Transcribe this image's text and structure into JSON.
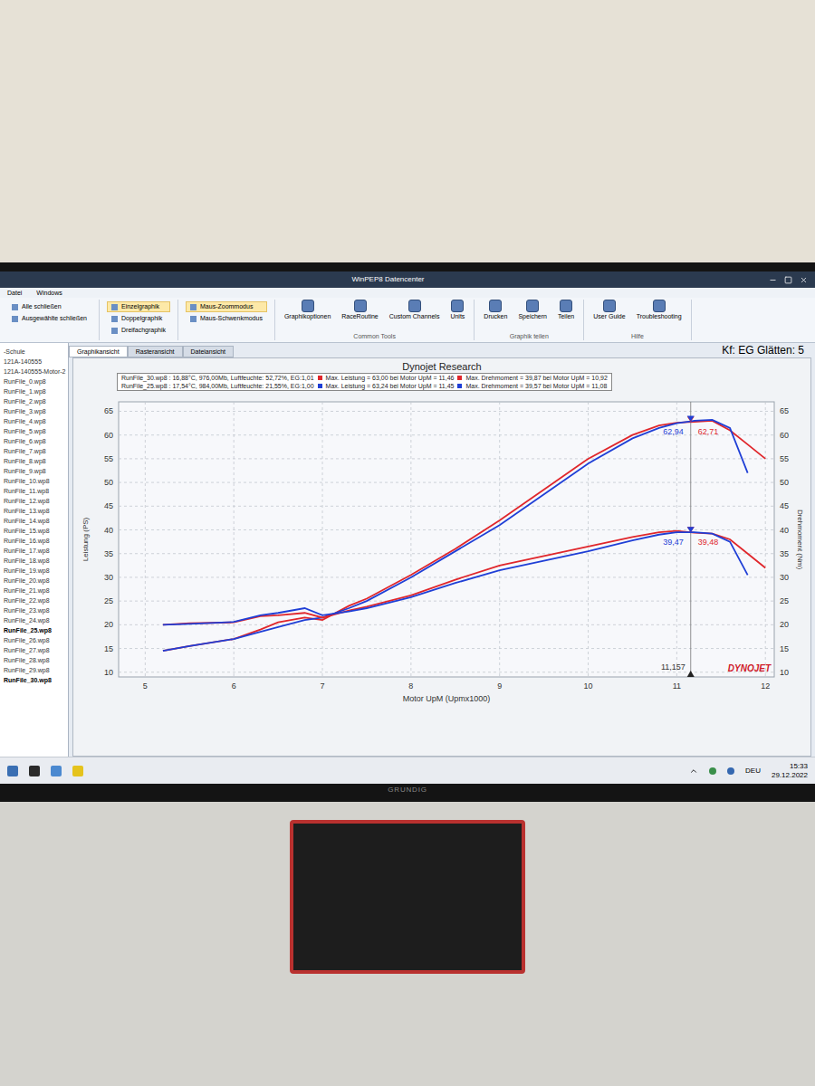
{
  "window": {
    "title": "WinPEP8 Datencenter"
  },
  "menu": [
    "Datei",
    "Windows"
  ],
  "ribbon": {
    "groups": [
      {
        "kind": "small",
        "items": [
          {
            "label": "Alle schließen",
            "selected": false
          },
          {
            "label": "Ausgewählte schließen",
            "selected": false
          }
        ]
      },
      {
        "kind": "small",
        "items": [
          {
            "label": "Einzelgraphik",
            "selected": true
          },
          {
            "label": "Doppelgraphik",
            "selected": false
          },
          {
            "label": "Dreifachgraphik",
            "selected": false
          }
        ]
      },
      {
        "kind": "small",
        "items": [
          {
            "label": "Maus-Zoommodus",
            "selected": true
          },
          {
            "label": "Maus-Schwenkmodus",
            "selected": false
          }
        ]
      },
      {
        "kind": "large",
        "label": "Common Tools",
        "items": [
          {
            "label": "Graphikoptionen",
            "selected": false
          },
          {
            "label": "RaceRoutine",
            "selected": false
          },
          {
            "label": "Custom Channels",
            "selected": false
          },
          {
            "label": "Units",
            "selected": false
          }
        ]
      },
      {
        "kind": "large",
        "label": "Graphik teilen",
        "items": [
          {
            "label": "Drucken",
            "selected": false
          },
          {
            "label": "Speichern",
            "selected": false
          },
          {
            "label": "Teilen",
            "selected": false
          }
        ]
      },
      {
        "kind": "large",
        "label": "Hilfe",
        "items": [
          {
            "label": "User Guide",
            "selected": false
          },
          {
            "label": "Troubleshooting",
            "selected": false
          }
        ]
      }
    ]
  },
  "tabs": [
    {
      "label": "Graphikansicht",
      "selected": true
    },
    {
      "label": "Rasteransicht",
      "selected": false
    },
    {
      "label": "Dateiansicht",
      "selected": false
    }
  ],
  "filter_label": "Kf: EG Glätten: 5",
  "sidebar": {
    "items": [
      {
        "label": "-Schule",
        "selected": false
      },
      {
        "label": "121A-140555",
        "selected": false
      },
      {
        "label": "121A-140555-Motor-2",
        "selected": false
      },
      {
        "label": "RunFile_0.wp8",
        "selected": false
      },
      {
        "label": "RunFile_1.wp8",
        "selected": false
      },
      {
        "label": "RunFile_2.wp8",
        "selected": false
      },
      {
        "label": "RunFile_3.wp8",
        "selected": false
      },
      {
        "label": "RunFile_4.wp8",
        "selected": false
      },
      {
        "label": "RunFile_5.wp8",
        "selected": false
      },
      {
        "label": "RunFile_6.wp8",
        "selected": false
      },
      {
        "label": "RunFile_7.wp8",
        "selected": false
      },
      {
        "label": "RunFile_8.wp8",
        "selected": false
      },
      {
        "label": "RunFile_9.wp8",
        "selected": false
      },
      {
        "label": "RunFile_10.wp8",
        "selected": false
      },
      {
        "label": "RunFile_11.wp8",
        "selected": false
      },
      {
        "label": "RunFile_12.wp8",
        "selected": false
      },
      {
        "label": "RunFile_13.wp8",
        "selected": false
      },
      {
        "label": "RunFile_14.wp8",
        "selected": false
      },
      {
        "label": "RunFile_15.wp8",
        "selected": false
      },
      {
        "label": "RunFile_16.wp8",
        "selected": false
      },
      {
        "label": "RunFile_17.wp8",
        "selected": false
      },
      {
        "label": "RunFile_18.wp8",
        "selected": false
      },
      {
        "label": "RunFile_19.wp8",
        "selected": false
      },
      {
        "label": "RunFile_20.wp8",
        "selected": false
      },
      {
        "label": "RunFile_21.wp8",
        "selected": false
      },
      {
        "label": "RunFile_22.wp8",
        "selected": false
      },
      {
        "label": "RunFile_23.wp8",
        "selected": false
      },
      {
        "label": "RunFile_24.wp8",
        "selected": false
      },
      {
        "label": "RunFile_25.wp8",
        "selected": true
      },
      {
        "label": "RunFile_26.wp8",
        "selected": false
      },
      {
        "label": "RunFile_27.wp8",
        "selected": false
      },
      {
        "label": "RunFile_28.wp8",
        "selected": false
      },
      {
        "label": "RunFile_29.wp8",
        "selected": false
      },
      {
        "label": "RunFile_30.wp8",
        "selected": true
      }
    ]
  },
  "chart": {
    "title": "Dynojet Research",
    "legend": [
      {
        "run": "RunFile_30.wp8 : 16,88°C, 976,00Mb, Luftfeuchte: 52,72%, EG:1,01",
        "power": "Max. Leistung = 63,00 bei Motor UpM = 11,46",
        "torque": "Max. Drehmoment = 39,87 bei Motor UpM = 10,92",
        "color": "#e0262b"
      },
      {
        "run": "RunFile_25.wp8 : 17,54°C, 984,00Mb, Luftfeuchte: 21,55%, EG:1,00",
        "power": "Max. Leistung = 63,24 bei Motor UpM = 11,45",
        "torque": "Max. Drehmoment = 39,57 bei Motor UpM = 11,08",
        "color": "#1f3fd6"
      }
    ],
    "x_axis": {
      "title": "Motor UpM (Upmx1000)",
      "ticks": [
        "5",
        "6",
        "7",
        "8",
        "9",
        "10",
        "11",
        "12"
      ]
    },
    "y_left": {
      "title": "Leistung (PS)",
      "ticks": [
        "10",
        "15",
        "20",
        "25",
        "30",
        "35",
        "40",
        "45",
        "50",
        "55",
        "60",
        "65"
      ]
    },
    "y_right": {
      "title": "Drehmoment (Nm)",
      "ticks": [
        "10",
        "15",
        "20",
        "25",
        "30",
        "35",
        "40",
        "45",
        "50",
        "55",
        "60",
        "65"
      ]
    },
    "cursor": {
      "rpm": 11.157,
      "label": "11,157"
    },
    "logo": "DYNOJET",
    "series": [
      {
        "axis": "left",
        "color": "#e0262b",
        "cursor_value": "62,71",
        "rpm": [
          5.2,
          5.5,
          6,
          6.3,
          6.5,
          6.8,
          7,
          7.3,
          7.5,
          8,
          8.5,
          9,
          9.5,
          10,
          10.5,
          10.8,
          11,
          11.2,
          11.4,
          11.6,
          11.8,
          12
        ],
        "values": [
          14.5,
          15.5,
          17,
          19,
          20.5,
          21.5,
          21,
          24,
          25.5,
          30.5,
          36,
          42,
          48.5,
          55,
          60,
          62,
          62.6,
          62.8,
          63,
          61,
          58,
          55
        ]
      },
      {
        "axis": "left",
        "color": "#1f3fd6",
        "cursor_value": "62,94",
        "rpm": [
          5.2,
          5.5,
          6,
          6.3,
          6.5,
          6.8,
          7,
          7.3,
          7.5,
          8,
          8.5,
          9,
          9.5,
          10,
          10.5,
          10.8,
          11,
          11.2,
          11.4,
          11.6,
          11.8
        ],
        "values": [
          14.5,
          15.5,
          17,
          18.5,
          19.5,
          21,
          21.5,
          23.5,
          25,
          30,
          35.5,
          41,
          47.5,
          54,
          59.3,
          61.5,
          62.5,
          63,
          63.2,
          61.5,
          52
        ]
      },
      {
        "axis": "right",
        "color": "#e0262b",
        "cursor_value": "39,48",
        "rpm": [
          5.2,
          5.5,
          6,
          6.3,
          6.5,
          6.8,
          7,
          7.3,
          7.5,
          8,
          8.5,
          9,
          9.5,
          10,
          10.5,
          10.8,
          11,
          11.2,
          11.4,
          11.6,
          11.8,
          12
        ],
        "values": [
          20,
          20.3,
          20.5,
          21.8,
          22,
          22.5,
          21.5,
          23,
          23.8,
          26.2,
          29.5,
          32.5,
          34.5,
          36.5,
          38.5,
          39.5,
          39.8,
          39.4,
          39.2,
          38,
          35,
          32
        ]
      },
      {
        "axis": "right",
        "color": "#1f3fd6",
        "cursor_value": "39,47",
        "rpm": [
          5.2,
          5.5,
          6,
          6.3,
          6.5,
          6.8,
          7,
          7.3,
          7.5,
          8,
          8.5,
          9,
          9.5,
          10,
          10.5,
          10.8,
          11,
          11.2,
          11.4,
          11.6,
          11.8
        ],
        "values": [
          20,
          20.2,
          20.6,
          22,
          22.5,
          23.5,
          22,
          22.8,
          23.5,
          25.8,
          28.8,
          31.5,
          33.5,
          35.5,
          37.8,
          39,
          39.5,
          39.5,
          39.2,
          37.5,
          30.5
        ]
      }
    ]
  },
  "taskbar": {
    "language": "DEU",
    "time": "15:33",
    "date": "29.12.2022"
  },
  "monitor": {
    "brand": "GRUNDIG"
  }
}
